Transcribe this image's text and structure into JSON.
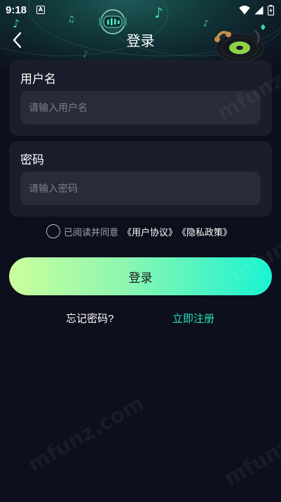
{
  "status_bar": {
    "time": "9:18",
    "notification_letter": "A",
    "icons": [
      "wifi-icon",
      "signal-icon",
      "battery-icon"
    ]
  },
  "nav": {
    "title": "登录",
    "back_icon": "chevron-left-icon"
  },
  "username_card": {
    "label": "用户名",
    "placeholder": "请输入用户名",
    "value": ""
  },
  "password_card": {
    "label": "密码",
    "placeholder": "请输入密码",
    "value": ""
  },
  "agreement": {
    "checked": false,
    "prefix": "已阅读并同意",
    "user_agreement": "《用户协议》",
    "privacy_policy": "《隐私政策》"
  },
  "login_button": {
    "label": "登录"
  },
  "links": {
    "forgot_password": "忘记密码?",
    "register": "立即注册"
  },
  "watermark": "mfunz.com",
  "colors": {
    "background": "#0e0f1c",
    "card": "#1c1d2c",
    "input": "#292a3a",
    "accent": "#26e3bf",
    "button_gradient_start": "#cbff9c",
    "button_gradient_end": "#18f3d2"
  }
}
